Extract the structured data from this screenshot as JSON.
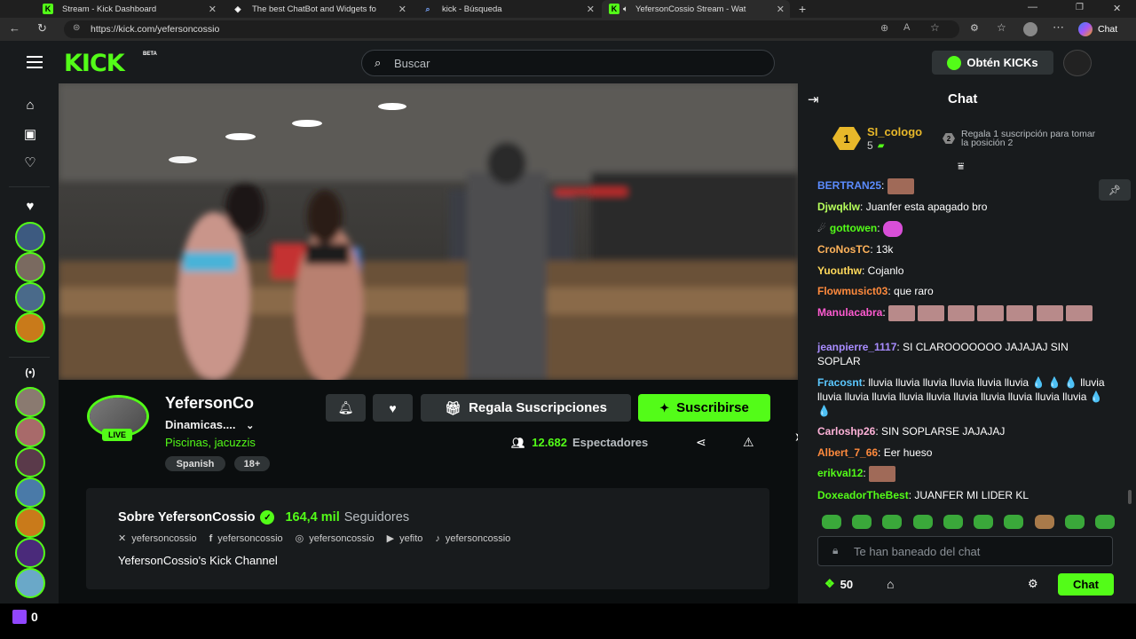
{
  "browser": {
    "tabs": [
      {
        "title": "Stream - Kick Dashboard",
        "active": false
      },
      {
        "title": "The best ChatBot and Widgets fo",
        "active": false
      },
      {
        "title": "kick - Búsqueda",
        "active": false
      },
      {
        "title": "YefersonCossio Stream - Wat",
        "active": true
      }
    ],
    "url": "https://kick.com/yefersoncossio",
    "chat_label": "Chat"
  },
  "header": {
    "logo": "KICK",
    "logo_badge": "BETA",
    "search_placeholder": "Buscar",
    "get_kicks": "Obtén KICKs"
  },
  "stream": {
    "streamer": "YefersonCo",
    "live_badge": "LIVE",
    "title": "Dinamicas....",
    "category": "Piscinas, jacuzzis",
    "tags": [
      "Spanish",
      "18+"
    ],
    "gift_label": "Regala Suscripciones",
    "subscribe_label": "Suscribirse",
    "viewers_count": "12.682",
    "viewers_label": "Espectadores"
  },
  "about": {
    "title": "Sobre YefersonCossio",
    "followers_count": "164,4 mil",
    "followers_label": "Seguidores",
    "socials": [
      {
        "icon": "x-icon",
        "handle": "yefersoncossio"
      },
      {
        "icon": "facebook-icon",
        "handle": "yefersoncossio"
      },
      {
        "icon": "instagram-icon",
        "handle": "yefersoncossio"
      },
      {
        "icon": "youtube-icon",
        "handle": "yefito"
      },
      {
        "icon": "tiktok-icon",
        "handle": "yefersoncossio"
      }
    ],
    "description": "YefersonCossio's Kick Channel"
  },
  "chat": {
    "title": "Chat",
    "leader_rank": "1",
    "leader_name": "SI_cologo",
    "leader_count": "5",
    "gift_rank": "2",
    "gift_text": "Regala 1 suscripción para tomar la posición 2",
    "messages": [
      {
        "user": "BERTRAN25",
        "color": "#5b8cff",
        "text": ""
      },
      {
        "user": "Djwqklw",
        "color": "#b6ff5b",
        "text": "Juanfer esta apagado bro"
      },
      {
        "user": "gottowen",
        "color": "#53fc18",
        "text": ""
      },
      {
        "user": "CroNosTC",
        "color": "#ffb35b",
        "text": "13k"
      },
      {
        "user": "Yuouthw",
        "color": "#ffd95b",
        "text": "Cojanlo"
      },
      {
        "user": "Flowmusict03",
        "color": "#ff8a3d",
        "text": "que raro"
      },
      {
        "user": "Manulacabra",
        "color": "#ff5bd1",
        "text": ""
      },
      {
        "user": "jeanpierre_1117",
        "color": "#a88cff",
        "text": "SI CLAROOOOOOO JAJAJAJ SIN SOPLAR"
      },
      {
        "user": "Fracosnt",
        "color": "#5bc8ff",
        "text": "lluvia lluvia lluvia lluvia lluvia lluvia 💧 💧 💧 lluvia lluvia lluvia lluvia lluvia lluvia lluvia lluvia lluvia lluvia lluvia 💧 💧"
      },
      {
        "user": "Carloshp26",
        "color": "#ffb3d9",
        "text": "SIN SOPLARSE JAJAJAJ"
      },
      {
        "user": "Albert_7_66",
        "color": "#ff8a3d",
        "text": "Eer hueso"
      },
      {
        "user": "erikval12",
        "color": "#53fc18",
        "text": ""
      },
      {
        "user": "DoxeadorTheBest",
        "color": "#53fc18",
        "text": "JUANFER MI LIDER KL"
      }
    ],
    "input_placeholder": "Te han baneado del chat",
    "points": "50",
    "send_label": "Chat"
  },
  "taskbar": {
    "count": "0"
  }
}
